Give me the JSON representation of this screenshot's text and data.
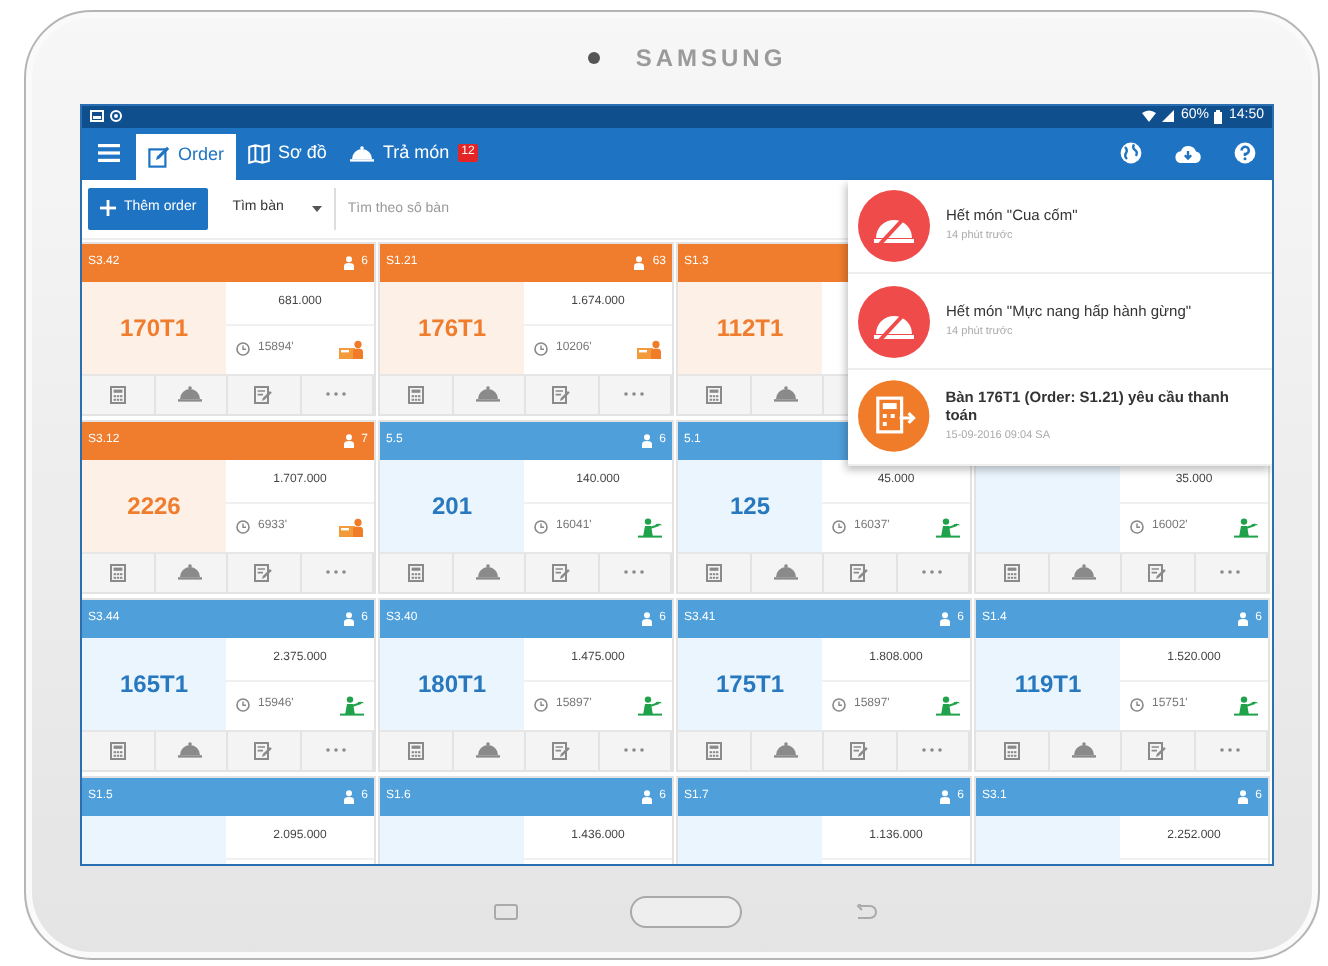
{
  "device": {
    "brand": "SAMSUNG"
  },
  "status_bar": {
    "battery": "60%",
    "time": "14:50"
  },
  "tabs": [
    {
      "label": "Order",
      "selected": true
    },
    {
      "label": "Sơ đồ",
      "selected": false
    },
    {
      "label": "Trả món",
      "selected": false,
      "badge": "12"
    }
  ],
  "toolbar": {
    "add_button": "Thêm order",
    "table_select": "Tìm bàn",
    "search": {
      "placeholder": "Tìm theo số bàn"
    }
  },
  "rows": [
    [
      {
        "code": "S3.42",
        "guests": "6",
        "name": "170T1",
        "amount": "681.000",
        "time": "15894'",
        "kind": "billing"
      },
      {
        "code": "S1.21",
        "guests": "63",
        "name": "176T1",
        "amount": "1.674.000",
        "time": "10206'",
        "kind": "billing"
      },
      {
        "code": "S1.3",
        "name": "112T1",
        "kind": "billing"
      }
    ],
    [
      {
        "code": "S3.12",
        "guests": "7",
        "name": "2226",
        "amount": "1.707.000",
        "time": "6933'",
        "kind": "billing"
      },
      {
        "code": "5.5",
        "guests": "6",
        "name": "201",
        "amount": "140.000",
        "time": "16041'",
        "kind": "serving"
      },
      {
        "code": "5.1",
        "name": "125",
        "amount": "45.000",
        "time": "16037'",
        "kind": "serving"
      },
      {
        "amount": "35.000",
        "time": "16002'",
        "kind": "serving"
      }
    ],
    [
      {
        "code": "S3.44",
        "guests": "6",
        "name": "165T1",
        "amount": "2.375.000",
        "time": "15946'",
        "kind": "serving"
      },
      {
        "code": "S3.40",
        "guests": "6",
        "name": "180T1",
        "amount": "1.475.000",
        "time": "15897'",
        "kind": "serving"
      },
      {
        "code": "S3.41",
        "guests": "6",
        "name": "175T1",
        "amount": "1.808.000",
        "time": "15897'",
        "kind": "serving"
      },
      {
        "code": "S1.4",
        "guests": "6",
        "name": "119T1",
        "amount": "1.520.000",
        "time": "15751'",
        "kind": "serving"
      }
    ],
    [
      {
        "code": "S1.5",
        "guests": "6",
        "amount": "2.095.000",
        "kind": "serving"
      },
      {
        "code": "S1.6",
        "guests": "6",
        "amount": "1.436.000",
        "kind": "serving"
      },
      {
        "code": "S1.7",
        "guests": "6",
        "amount": "1.136.000",
        "kind": "serving"
      },
      {
        "code": "S3.1",
        "guests": "6",
        "amount": "2.252.000",
        "kind": "serving"
      }
    ]
  ],
  "notifications": [
    {
      "kind": "out_of_stock",
      "title": "Hết món \"Cua cốm\"",
      "time": "14 phút trước"
    },
    {
      "kind": "out_of_stock",
      "title": "Hết món \"Mực nang hấp hành gừng\"",
      "time": "14 phút trước"
    },
    {
      "kind": "payment_request",
      "title": "Bàn 176T1 (Order: S1.21) yêu cầu thanh toán",
      "time": "15-09-2016 09:04 SA"
    }
  ]
}
